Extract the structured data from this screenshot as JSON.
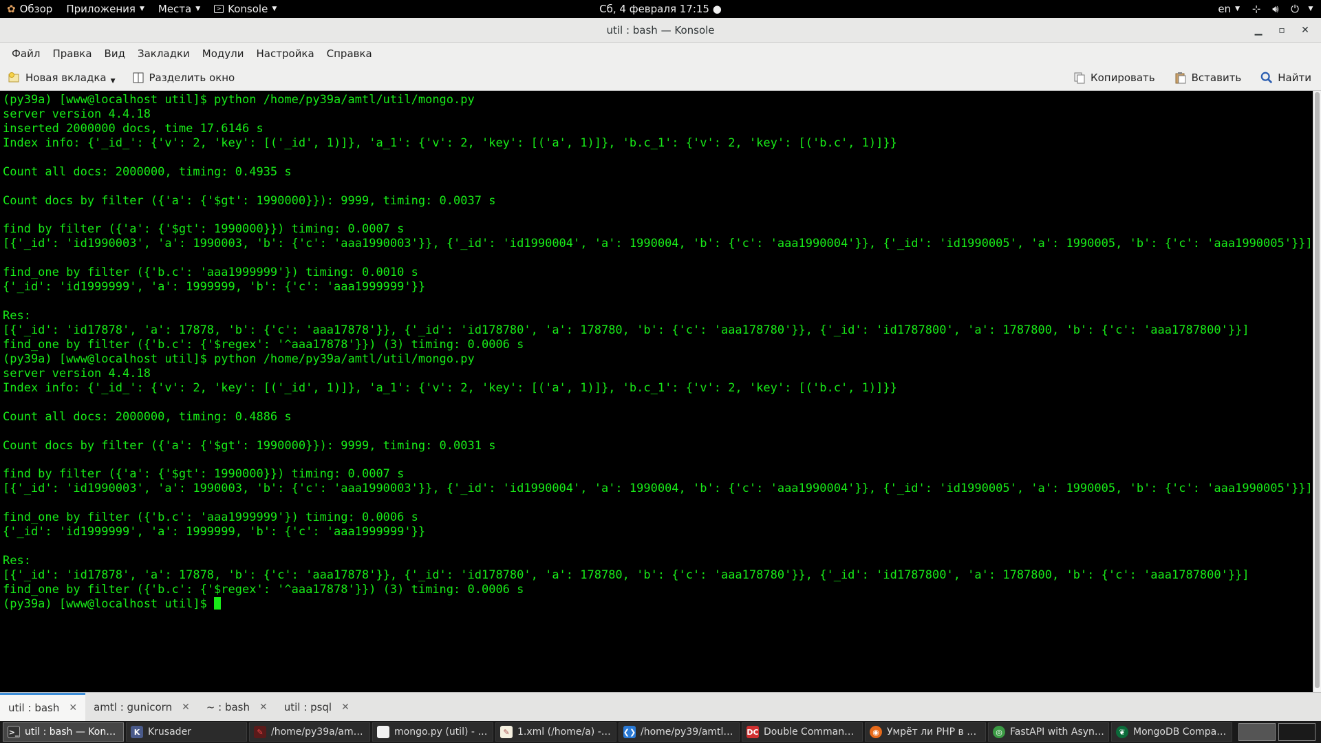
{
  "topbar": {
    "overview": "Обзор",
    "applications": "Приложения",
    "places": "Места",
    "app_menu": "Konsole",
    "clock": "Сб, 4 февраля  17:15 ●",
    "lang": "en"
  },
  "window": {
    "title": "util : bash — Konsole"
  },
  "menu": [
    "Файл",
    "Правка",
    "Вид",
    "Закладки",
    "Модули",
    "Настройка",
    "Справка"
  ],
  "toolbar": {
    "new_tab": "Новая вкладка",
    "split_view": "Разделить окно",
    "copy": "Копировать",
    "paste": "Вставить",
    "find": "Найти"
  },
  "terminal": {
    "lines": [
      "(py39a) [www@localhost util]$ python /home/py39a/amtl/util/mongo.py",
      "server version 4.4.18",
      "inserted 2000000 docs, time 17.6146 s",
      "Index info: {'_id_': {'v': 2, 'key': [('_id', 1)]}, 'a_1': {'v': 2, 'key': [('a', 1)]}, 'b.c_1': {'v': 2, 'key': [('b.c', 1)]}}",
      "",
      "Count all docs: 2000000, timing: 0.4935 s",
      "",
      "Count docs by filter ({'a': {'$gt': 1990000}}): 9999, timing: 0.0037 s",
      "",
      "find by filter ({'a': {'$gt': 1990000}}) timing: 0.0007 s",
      "[{'_id': 'id1990003', 'a': 1990003, 'b': {'c': 'aaa1990003'}}, {'_id': 'id1990004', 'a': 1990004, 'b': {'c': 'aaa1990004'}}, {'_id': 'id1990005', 'a': 1990005, 'b': {'c': 'aaa1990005'}}]",
      "",
      "find_one by filter ({'b.c': 'aaa1999999'}) timing: 0.0010 s",
      "{'_id': 'id1999999', 'a': 1999999, 'b': {'c': 'aaa1999999'}}",
      "",
      "Res:",
      "[{'_id': 'id17878', 'a': 17878, 'b': {'c': 'aaa17878'}}, {'_id': 'id178780', 'a': 178780, 'b': {'c': 'aaa178780'}}, {'_id': 'id1787800', 'a': 1787800, 'b': {'c': 'aaa1787800'}}]",
      "find_one by filter ({'b.c': {'$regex': '^aaa17878'}}) (3) timing: 0.0006 s",
      "(py39a) [www@localhost util]$ python /home/py39a/amtl/util/mongo.py",
      "server version 4.4.18",
      "Index info: {'_id_': {'v': 2, 'key': [('_id', 1)]}, 'a_1': {'v': 2, 'key': [('a', 1)]}, 'b.c_1': {'v': 2, 'key': [('b.c', 1)]}}",
      "",
      "Count all docs: 2000000, timing: 0.4886 s",
      "",
      "Count docs by filter ({'a': {'$gt': 1990000}}): 9999, timing: 0.0031 s",
      "",
      "find by filter ({'a': {'$gt': 1990000}}) timing: 0.0007 s",
      "[{'_id': 'id1990003', 'a': 1990003, 'b': {'c': 'aaa1990003'}}, {'_id': 'id1990004', 'a': 1990004, 'b': {'c': 'aaa1990004'}}, {'_id': 'id1990005', 'a': 1990005, 'b': {'c': 'aaa1990005'}}]",
      "",
      "find_one by filter ({'b.c': 'aaa1999999'}) timing: 0.0006 s",
      "{'_id': 'id1999999', 'a': 1999999, 'b': {'c': 'aaa1999999'}}",
      "",
      "Res:",
      "[{'_id': 'id17878', 'a': 17878, 'b': {'c': 'aaa17878'}}, {'_id': 'id178780', 'a': 178780, 'b': {'c': 'aaa178780'}}, {'_id': 'id1787800', 'a': 1787800, 'b': {'c': 'aaa1787800'}}]",
      "find_one by filter ({'b.c': {'$regex': '^aaa17878'}}) (3) timing: 0.0006 s"
    ],
    "prompt": "(py39a) [www@localhost util]$ ",
    "text_color": "#18eb18"
  },
  "tabs": [
    {
      "label": "util : bash",
      "active": true
    },
    {
      "label": "amtl : gunicorn",
      "active": false
    },
    {
      "label": "~ : bash",
      "active": false
    },
    {
      "label": "util : psql",
      "active": false
    }
  ],
  "taskbar": [
    {
      "label": "util : bash — Konsole",
      "icon": "terminal-icon",
      "active": true
    },
    {
      "label": "Krusader",
      "icon": "krusader-icon",
      "active": false
    },
    {
      "label": "/home/py39a/amtl -...",
      "icon": "editor-icon",
      "active": false
    },
    {
      "label": "mongo.py (util) - Br...",
      "icon": "document-icon",
      "active": false
    },
    {
      "label": "1.xml (/home/a) - ge...",
      "icon": "gedit-icon",
      "active": false
    },
    {
      "label": "/home/py39/amtl_a...",
      "icon": "vscode-icon",
      "active": false
    },
    {
      "label": "Double Commander...",
      "icon": "doublecmd-icon",
      "active": false
    },
    {
      "label": "Умрёт ли PHP в 20...",
      "icon": "firefox-icon",
      "active": false
    },
    {
      "label": "FastAPI with Async ...",
      "icon": "chrome-icon",
      "active": false
    },
    {
      "label": "MongoDB Compass ...",
      "icon": "mongodb-icon",
      "active": false
    }
  ]
}
